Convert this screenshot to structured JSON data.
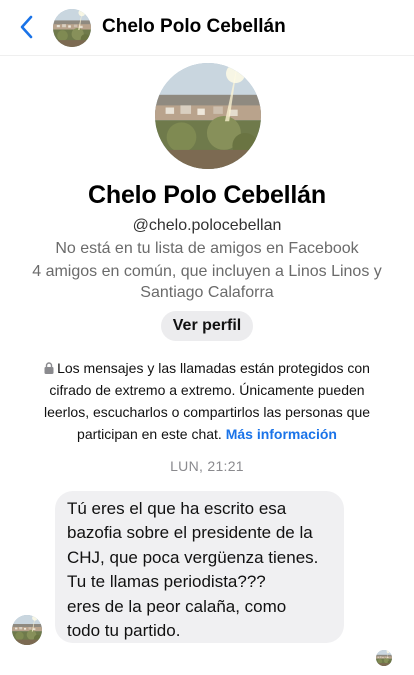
{
  "header": {
    "back_icon": "chevron-left-icon",
    "contact_name": "Chelo Polo Cebellán",
    "accent_color": "#1a73e8"
  },
  "profile": {
    "name": "Chelo Polo Cebellán",
    "handle": "@chelo.polocebellan",
    "friend_status": "No está en tu lista de amigos en Facebook",
    "mutual_friends": "4 amigos en común, que incluyen a Linos Linos y Santiago Calaforra",
    "view_profile_label": "Ver perfil"
  },
  "encryption": {
    "icon": "lock-icon",
    "notice": "Los mensajes y las llamadas están protegidos con cifrado de extremo a extremo. Únicamente pueden leerlos, escucharlos o compartirlos las personas que participan en este chat.",
    "link_text": "Más información"
  },
  "conversation": {
    "timestamp": "LUN, 21:21",
    "message": "Tú eres el que ha escrito  esa\nbazofia sobre el presidente de la\nCHJ, que poca vergüenza tienes.\nTu te llamas periodista???\neres de la peor calaña, como\ntodo tu partido."
  }
}
